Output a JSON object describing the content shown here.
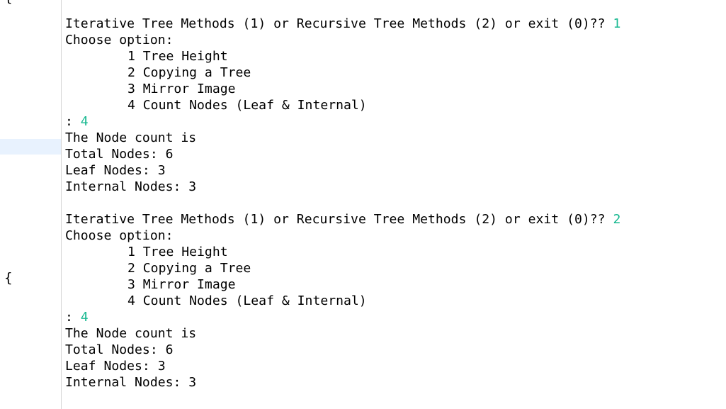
{
  "editor": {
    "brace_char": "{"
  },
  "console": {
    "blocks": [
      {
        "prompt": "Iterative Tree Methods (1) or Recursive Tree Methods (2) or exit (0)?? ",
        "prompt_input": "1",
        "choose": "Choose option:",
        "options": [
          "1 Tree Height",
          "2 Copying a Tree",
          "3 Mirror Image",
          "4 Count Nodes (Leaf & Internal)"
        ],
        "option_prefix": ": ",
        "option_input": "4",
        "results": [
          "The Node count is",
          "Total Nodes: 6",
          "Leaf Nodes: 3",
          "Internal Nodes: 3"
        ]
      },
      {
        "prompt": "Iterative Tree Methods (1) or Recursive Tree Methods (2) or exit (0)?? ",
        "prompt_input": "2",
        "choose": "Choose option:",
        "options": [
          "1 Tree Height",
          "2 Copying a Tree",
          "3 Mirror Image",
          "4 Count Nodes (Leaf & Internal)"
        ],
        "option_prefix": ": ",
        "option_input": "4",
        "results": [
          "The Node count is",
          "Total Nodes: 6",
          "Leaf Nodes: 3",
          "Internal Nodes: 3"
        ]
      }
    ]
  }
}
